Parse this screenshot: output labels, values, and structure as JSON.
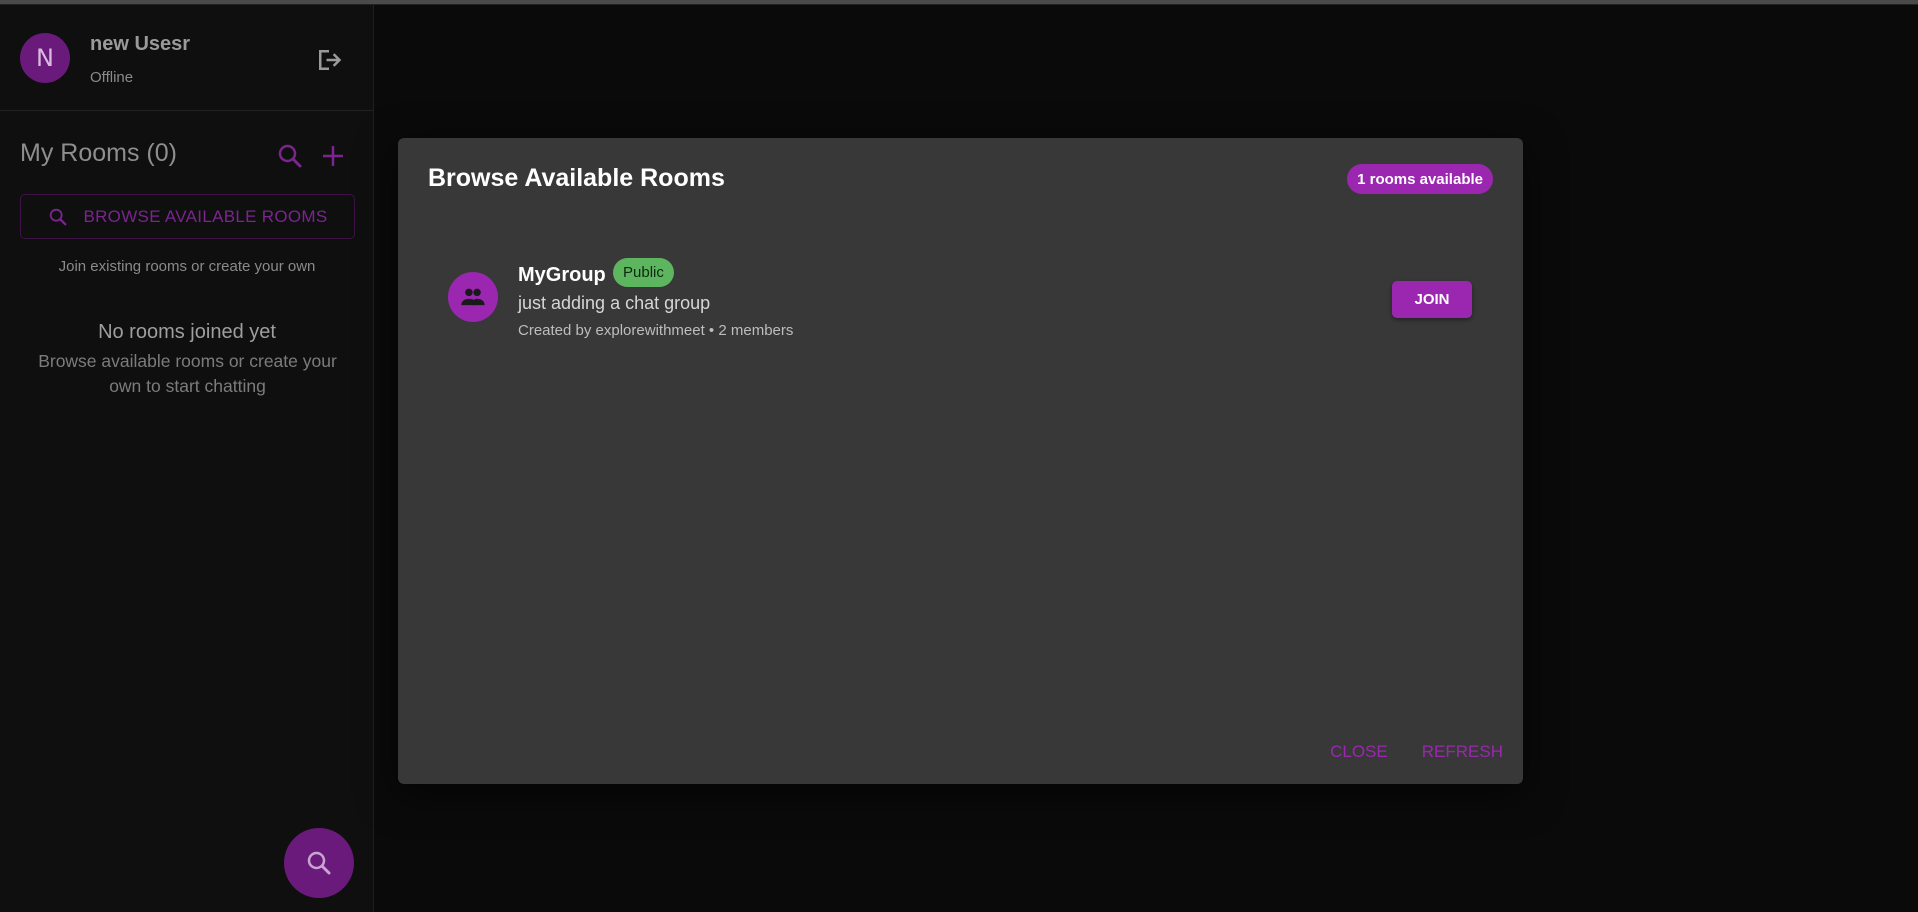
{
  "user": {
    "initial": "N",
    "name": "new Usesr",
    "status": "Offline"
  },
  "sidebar": {
    "rooms_title": "My Rooms (0)",
    "browse_button_label": "BROWSE AVAILABLE ROOMS",
    "join_hint": "Join existing rooms or create your own",
    "empty_title": "No rooms joined yet",
    "empty_description": "Browse available rooms or create your own to start chatting"
  },
  "dialog": {
    "title": "Browse Available Rooms",
    "count_badge": "1 rooms available",
    "rooms": [
      {
        "name": "MyGroup",
        "visibility": "Public",
        "description": "just adding a chat group",
        "meta": "Created by explorewithmeet • 2 members",
        "join_label": "JOIN"
      }
    ],
    "close_label": "CLOSE",
    "refresh_label": "REFRESH"
  },
  "colors": {
    "accent": "#9b27b0",
    "accent_dim": "#6a1a7a",
    "public_badge": "#5db560",
    "dialog_bg": "#383838",
    "page_bg": "#0a0a0a"
  },
  "icons": {
    "logout": "logout-icon",
    "search": "search-icon",
    "add": "plus-icon",
    "room": "group-icon"
  }
}
